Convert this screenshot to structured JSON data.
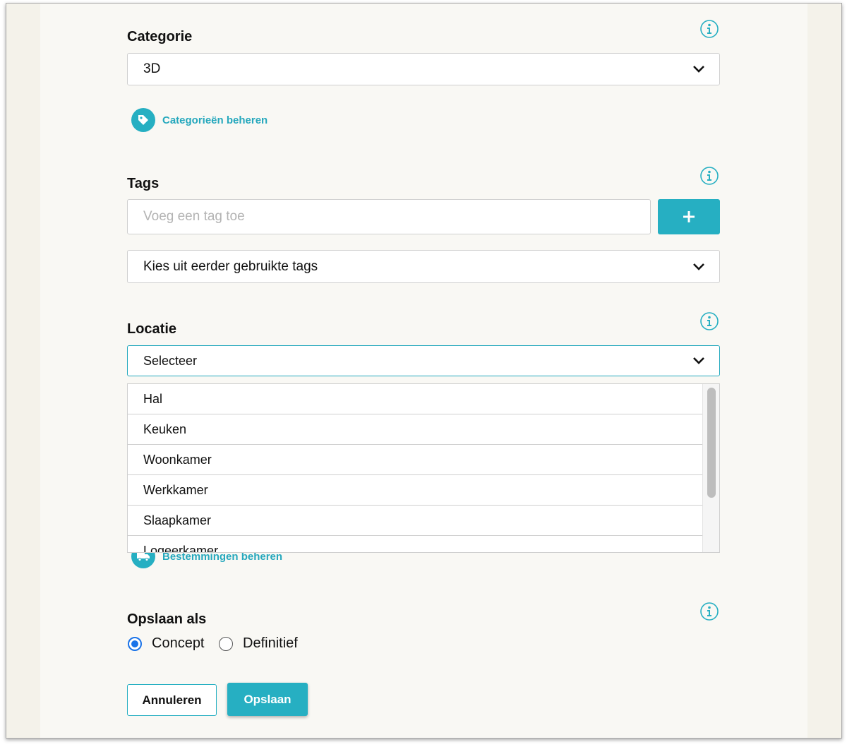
{
  "category": {
    "label": "Categorie",
    "selected": "3D",
    "manage_link": "Categorieën beheren"
  },
  "tags": {
    "label": "Tags",
    "input_placeholder": "Voeg een tag toe",
    "add_button_symbol": "+",
    "previous_tags_select": "Kies uit eerder gebruikte tags"
  },
  "location": {
    "label": "Locatie",
    "selected": "Selecteer",
    "options": [
      "Hal",
      "Keuken",
      "Woonkamer",
      "Werkkamer",
      "Slaapkamer",
      "Logeerkamer"
    ],
    "manage_link": "Bestemmingen beheren"
  },
  "save_as": {
    "label": "Opslaan als",
    "options": [
      "Concept",
      "Definitief"
    ],
    "selected": "Concept"
  },
  "actions": {
    "cancel": "Annuleren",
    "save": "Opslaan"
  },
  "colors": {
    "accent": "#26afc2",
    "background": "#f9f8f4",
    "radio_selected": "#1a73e8"
  },
  "icons": {
    "info": "info-circle-icon",
    "chevron": "chevron-down-icon",
    "tag": "tag-icon",
    "truck": "truck-icon",
    "plus": "plus-icon"
  }
}
